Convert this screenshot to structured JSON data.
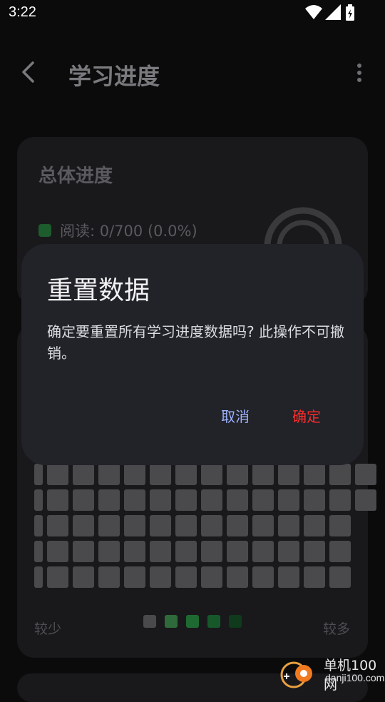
{
  "status_bar": {
    "time": "3:22",
    "icons": [
      "wifi-icon",
      "signal-icon",
      "battery-charging-icon"
    ]
  },
  "app_bar": {
    "title": "学习进度",
    "back_icon": "chevron-left-icon",
    "more_icon": "more-vertical-icon"
  },
  "overall_card": {
    "title": "总体进度",
    "reading_label": "阅读: 0/700  (0.0%)",
    "progress_fraction": 0.0,
    "legend_color": "#1d5c2c"
  },
  "heatmap_card": {
    "scale_less": "较少",
    "scale_more": "较多",
    "scale_colors": [
      "#4a4a4d",
      "#2f6a3a",
      "#1f6a32",
      "#17582a",
      "#0f3a1c"
    ],
    "cell_color": "#4a4a4d"
  },
  "dialog": {
    "title": "重置数据",
    "message": "确定要重置所有学习进度数据吗? 此操作不可撤销。",
    "cancel_label": "取消",
    "confirm_label": "确定",
    "cancel_color": "#9fb4ff",
    "confirm_color": "#ff2b2b"
  },
  "watermark": {
    "name_cn": "单机100网",
    "domain": "danji100.com"
  }
}
